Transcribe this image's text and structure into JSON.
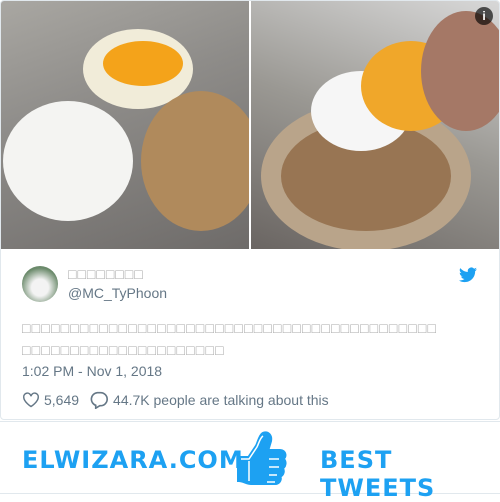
{
  "tweet": {
    "display_name": "□□□□□□□□",
    "handle": "@MC_TyPhoon",
    "text": "□□□□□□□□□□□□□□□□□□□□□□□□□□□□□□□□□□□□□□□□□□□ □□□□□□□□□□□□□□□□□□□□□",
    "timestamp": "1:02 PM - Nov 1, 2018",
    "likes": "5,649",
    "talking": "44.7K people are talking about this",
    "info_label": "i"
  },
  "footer": {
    "left": "ELWIZARA.COM",
    "right": "BEST TWEETS"
  },
  "colors": {
    "accent": "#1da1f2",
    "muted": "#657786"
  }
}
